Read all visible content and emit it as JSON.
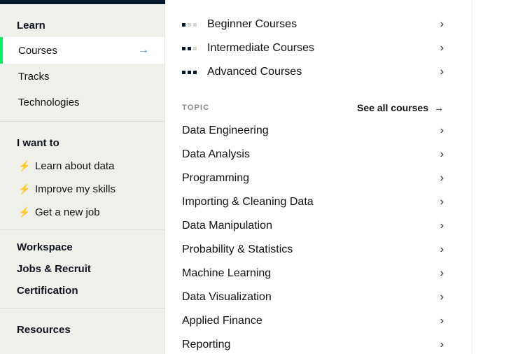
{
  "sidebar": {
    "learn": {
      "heading": "Learn",
      "items": [
        {
          "label": "Courses",
          "active": true
        },
        {
          "label": "Tracks"
        },
        {
          "label": "Technologies"
        }
      ]
    },
    "want": {
      "heading": "I want to",
      "items": [
        {
          "label": "Learn about data"
        },
        {
          "label": "Improve my skills"
        },
        {
          "label": "Get a new job"
        }
      ]
    },
    "other": {
      "items": [
        {
          "label": "Workspace"
        },
        {
          "label": "Jobs & Recruit"
        },
        {
          "label": "Certification"
        }
      ]
    },
    "resources": {
      "heading": "Resources"
    }
  },
  "main": {
    "levels": [
      {
        "label": "Beginner Courses",
        "tier": "beg"
      },
      {
        "label": "Intermediate Courses",
        "tier": "int"
      },
      {
        "label": "Advanced Courses",
        "tier": "adv"
      }
    ],
    "topic_heading": "Topic",
    "see_all": "See all courses",
    "topics": [
      "Data Engineering",
      "Data Analysis",
      "Programming",
      "Importing & Cleaning Data",
      "Data Manipulation",
      "Probability & Statistics",
      "Machine Learning",
      "Data Visualization",
      "Applied Finance",
      "Reporting"
    ]
  }
}
